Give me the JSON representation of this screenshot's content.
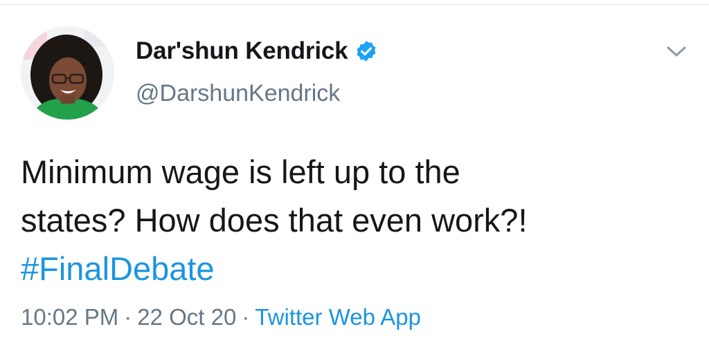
{
  "colors": {
    "text_primary": "#14171a",
    "text_secondary": "#657786",
    "link": "#1b95e0",
    "verified_badge": "#1da1f2"
  },
  "author": {
    "display_name": "Dar'shun Kendrick",
    "handle": "@DarshunKendrick",
    "verified": true,
    "verified_icon": "verified-badge-icon",
    "avatar_icon": "profile-photo"
  },
  "menu": {
    "icon": "chevron-down-icon"
  },
  "tweet": {
    "line_1": "Minimum wage is left up to the",
    "line_2": "states? How does that even work?!",
    "hashtag": "#FinalDebate"
  },
  "meta": {
    "time": "10:02 PM",
    "separator_1": "·",
    "date": "22 Oct 20",
    "separator_2": "·",
    "source": "Twitter Web App"
  }
}
